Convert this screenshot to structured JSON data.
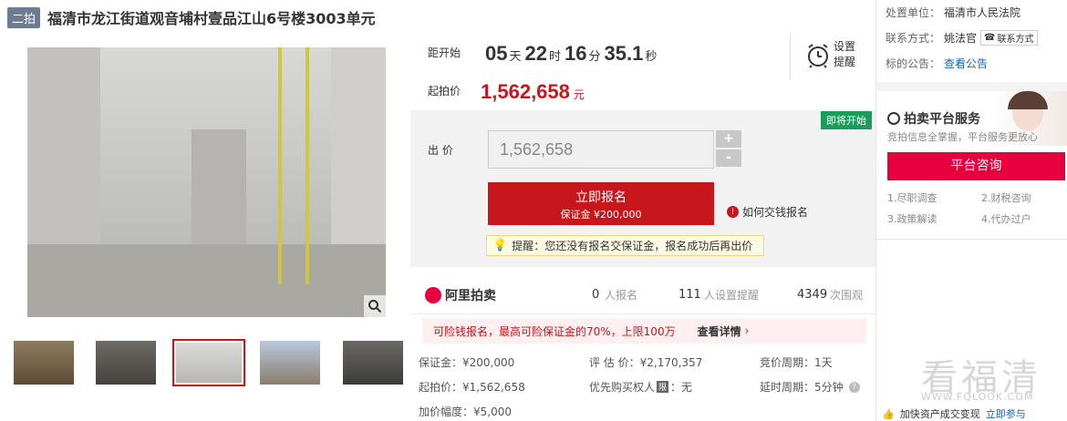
{
  "header": {
    "tag": "二拍",
    "title": "福清市龙江街道观音埔村壹品江山6号楼3003单元"
  },
  "countdown": {
    "label": "距开始",
    "days": "05",
    "days_unit": "天",
    "hours": "22",
    "hours_unit": "时",
    "minutes": "16",
    "minutes_unit": "分",
    "seconds": "35.1",
    "seconds_unit": "秒"
  },
  "remind": {
    "line1": "设置",
    "line2": "提醒"
  },
  "start_price": {
    "label": "起拍价",
    "value": "1,562,658",
    "unit": "元"
  },
  "bid": {
    "status_badge": "即将开始",
    "label": "出 价",
    "input_value": "1,562,658",
    "plus": "+",
    "minus": "-",
    "signup_label": "立即报名",
    "deposit_label": "保证金 ¥200,000",
    "how_to_label": "如何交钱报名",
    "tip": "提醒：您还没有报名交保证金，报名成功后再出价"
  },
  "ali": {
    "logo": "阿里拍卖",
    "signups": "0",
    "signups_label": "人报名",
    "reminders": "111",
    "reminders_label": "人设置提醒",
    "views": "4349",
    "views_label": "次围观"
  },
  "promo": {
    "text": "可险钱报名，最高可险保证金的70%，上限100万",
    "link": "查看详情"
  },
  "details": {
    "deposit": "保证金：¥200,000",
    "appraisal": "评 估 价：¥2,170,357",
    "period": "竞价周期：1天",
    "start_price": "起拍价：¥1,562,658",
    "priority_label": "优先购买权人",
    "priority_badge": "限",
    "priority_value": "：无",
    "delay": "延时周期：5分钟",
    "increment": "加价幅度：¥5,000"
  },
  "disposal": {
    "unit_label": "处置单位：",
    "unit_value": "福清市人民法院",
    "contact_label": "联系方式：",
    "contact_value": "姚法官",
    "contact_btn": "联系方式",
    "notice_label": "标的公告：",
    "notice_link": "查看公告"
  },
  "service": {
    "title": "拍卖平台服务",
    "subtitle": "竞拍信息全掌握，平台服务更放心",
    "consult_btn": "平台咨询",
    "items": [
      "1.尽职调查",
      "2.财税咨询",
      "3.政策解读",
      "4.代办过户"
    ]
  },
  "bottom_notice": {
    "text": "加快资产成交变现",
    "link": "立即参与"
  },
  "watermark": {
    "main": "看福清",
    "sub": "WWW.FQLOOK.COM"
  },
  "colors": {
    "accent": "#c8161d",
    "badge_green": "#1a9d5a",
    "consult": "#e6003d",
    "link": "#1a63b5"
  }
}
